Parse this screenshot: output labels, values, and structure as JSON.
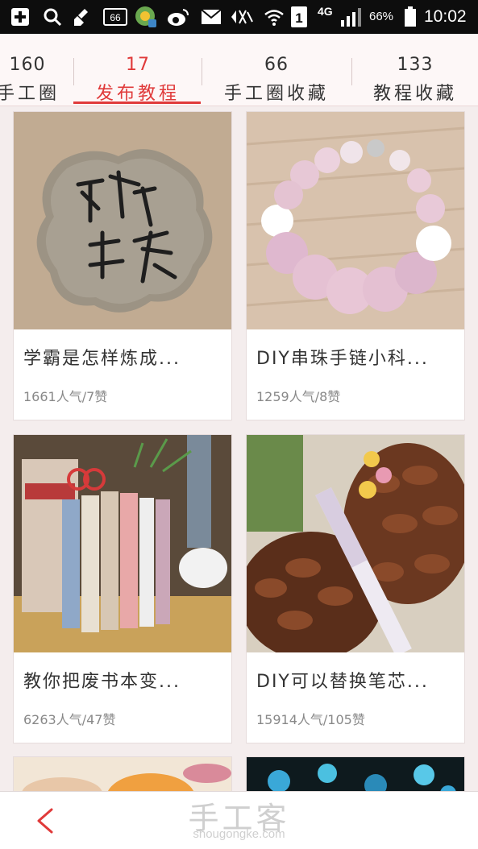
{
  "status_bar": {
    "sim_badge": "66",
    "network": "4G",
    "sim_slot": "1",
    "battery": "66%",
    "time": "10:02",
    "icons": [
      "add-icon",
      "search-icon",
      "cleaner-icon",
      "sim-badge-icon",
      "app-icon",
      "weibo-icon",
      "mail-icon",
      "silent-icon",
      "wifi-icon",
      "sim-slot-icon",
      "signal-icon",
      "battery-icon"
    ]
  },
  "tabs": [
    {
      "count": "160",
      "label": "手工圈"
    },
    {
      "count": "17",
      "label": "发布教程",
      "active": true
    },
    {
      "count": "66",
      "label": "手工圈收藏"
    },
    {
      "count": "133",
      "label": "教程收藏"
    }
  ],
  "cards": [
    {
      "title": "学霸是怎样炼成...",
      "stats": "1661人气/7赞",
      "image": "clay-medallion-photo"
    },
    {
      "title": "DIY串珠手链小科...",
      "stats": "1259人气/8赞",
      "image": "pink-bead-bracelet-photo"
    },
    {
      "title": "教你把废书本变...",
      "stats": "6263人气/47赞",
      "image": "book-bookends-photo"
    },
    {
      "title": "DIY可以替换笔芯...",
      "stats": "15914人气/105赞",
      "image": "pinecone-pen-photo"
    },
    {
      "image": "fruit-plate-photo"
    },
    {
      "image": "blue-flowers-photo"
    }
  ],
  "bottom": {
    "brand": "手工客",
    "url": "shougongke.com"
  },
  "colors": {
    "accent": "#e03a3a",
    "background": "#f4eded"
  }
}
